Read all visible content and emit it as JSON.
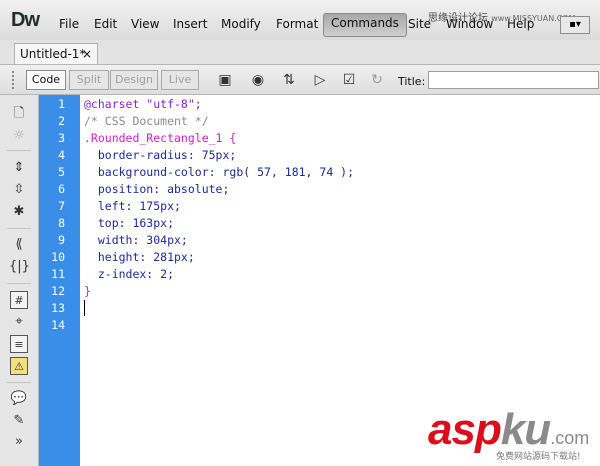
{
  "app": {
    "logo": "Dw"
  },
  "menu": [
    "File",
    "Edit",
    "View",
    "Insert",
    "Modify",
    "Format",
    "Commands",
    "Site",
    "Window",
    "Help"
  ],
  "menu_active": "Commands",
  "layout_selector": "▪▾",
  "watermark_top": {
    "text": "思缘设计论坛",
    "url": "www.MISSYUAN.COM"
  },
  "tab": {
    "label": "Untitled-1*",
    "close": "×"
  },
  "view_buttons": {
    "code": "Code",
    "split": "Split",
    "design": "Design",
    "live": "Live"
  },
  "toolbar": {
    "title_label": "Title:",
    "title_value": ""
  },
  "icons": {
    "toolbar": [
      "multiscreen-icon",
      "preview-globe-icon",
      "file-management-icon",
      "w3c-validation-icon",
      "check-browser-icon",
      "refresh-icon"
    ],
    "sidebar": [
      "open-documents-icon",
      "show-code-navigator-icon",
      "collapse-full-tag-icon",
      "collapse-selection-icon",
      "expand-all-icon",
      "select-parent-tag-icon",
      "balance-braces-icon",
      "line-numbers-icon",
      "highlight-invalid-code-icon",
      "word-wrap-icon",
      "syntax-error-alerts-icon",
      "apply-comment-icon",
      "remove-comment-icon",
      "more-icon"
    ]
  },
  "editor": {
    "line_numbers": [
      "1",
      "2",
      "3",
      "4",
      "5",
      "6",
      "7",
      "8",
      "9",
      "10",
      "11",
      "12",
      "13",
      "14"
    ],
    "lines": [
      "@charset \"utf-8\";",
      "/* CSS Document */",
      ".Rounded_Rectangle_1 {",
      "  border-radius: 75px;",
      "  background-color: rgb( 57, 181, 74 );",
      "  position: absolute;",
      "  left: 175px;",
      "  top: 163px;",
      "  width: 304px;",
      "  height: 281px;",
      "  z-index: 2;",
      "}",
      "",
      ""
    ]
  },
  "watermark_bottom": {
    "asp": "asp",
    "ku": "ku",
    "dotcom": ".com",
    "sub": "免费网站源码下载站!"
  },
  "colors": {
    "gutter": "#3b8ee8",
    "keyword": "#8e1fd3",
    "comment": "#8a8a8a",
    "selector": "#d020c8",
    "property": "#1a2a9a"
  }
}
